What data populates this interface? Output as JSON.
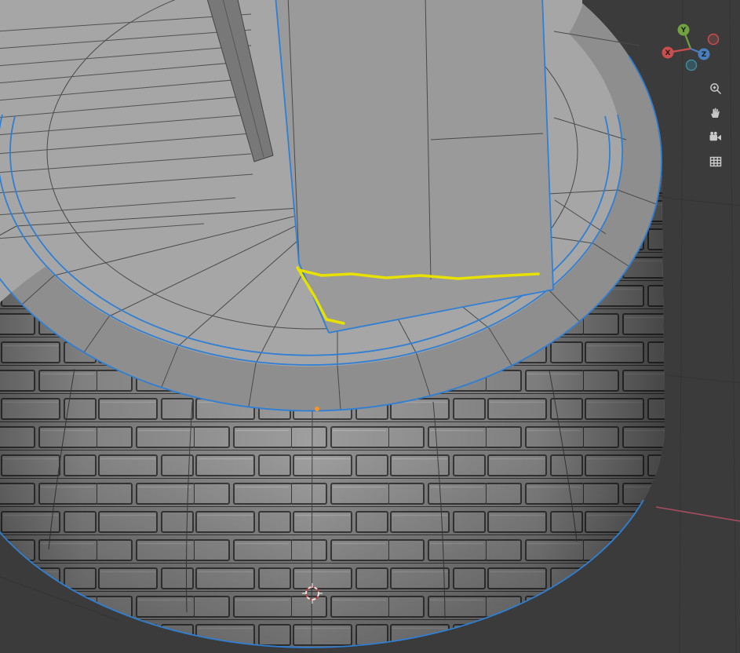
{
  "viewport": {
    "background_color": "#3b3b3b",
    "grid_line_color": "#343434",
    "x_axis_line_color": "#a84d62",
    "mesh": {
      "top_color": "#a6a6a6",
      "rim_color": "#8e8e8e",
      "side_color": "#909090",
      "pillar_color": "#9a9a9a",
      "slot_color": "#787878",
      "wire_color": "#4a4a4a",
      "stair_wire_color": "#525252",
      "selected_edge_color": "#2f7fd4",
      "active_edge_color": "#e8e100",
      "origin_dot_color": "#ff9326",
      "cursor_ring_red": "#c04040",
      "cursor_ring_white": "#e8e8e8"
    }
  },
  "gizmo": {
    "axes": {
      "x": {
        "label": "X",
        "color": "#cc4d4d"
      },
      "y": {
        "label": "Y",
        "color": "#70a33f"
      },
      "z": {
        "label": "Z",
        "color": "#4a7fbd"
      }
    }
  },
  "toolbar": {
    "buttons": [
      {
        "name": "zoom-in",
        "icon": "magnifier-plus-icon"
      },
      {
        "name": "pan",
        "icon": "hand-icon"
      },
      {
        "name": "camera-view",
        "icon": "camera-icon"
      },
      {
        "name": "toggle-grid-view",
        "icon": "grid-icon"
      }
    ]
  }
}
